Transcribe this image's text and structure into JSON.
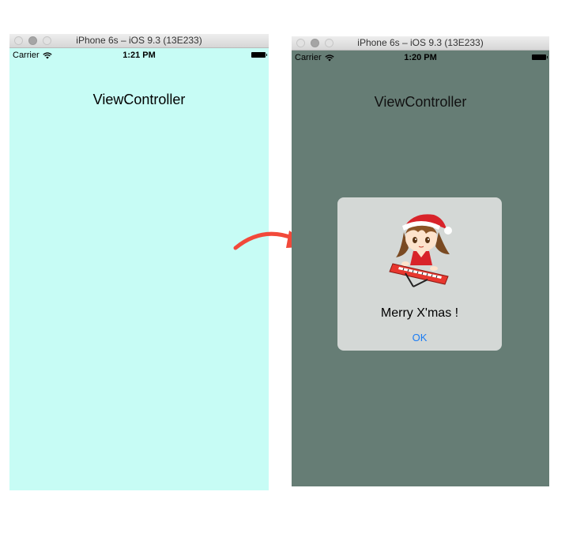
{
  "left_window": {
    "title": "iPhone 6s – iOS 9.3 (13E233)",
    "status": {
      "carrier": "Carrier",
      "time": "1:21 PM"
    },
    "screen_title": "ViewController",
    "background": "#c7fcf5"
  },
  "right_window": {
    "title": "iPhone 6s – iOS 9.3 (13E233)",
    "status": {
      "carrier": "Carrier",
      "time": "1:20 PM"
    },
    "screen_title": "ViewController",
    "background": "#667d75",
    "alert": {
      "image_icon": "santa-girl-keyboard-illustration",
      "message": "Merry X'mas !",
      "ok_label": "OK"
    }
  },
  "arrow": {
    "color": "#f2493a",
    "icon": "curved-arrow-right-icon"
  }
}
